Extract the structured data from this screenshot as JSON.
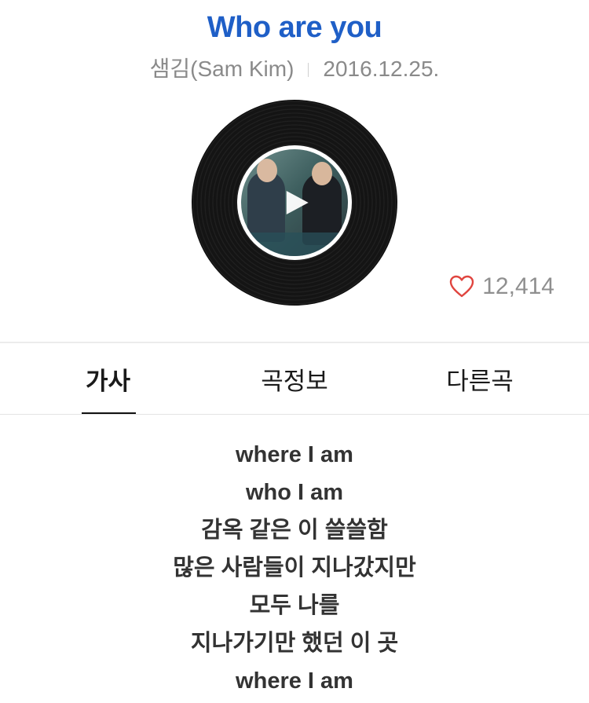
{
  "song": {
    "title": "Who are you",
    "artist": "샘김(Sam Kim)",
    "date": "2016.12.25."
  },
  "player": {
    "like_count": "12,414",
    "play_icon": "play-icon",
    "heart_icon": "heart-outline-icon"
  },
  "tabs": [
    {
      "label": "가사",
      "active": true
    },
    {
      "label": "곡정보",
      "active": false
    },
    {
      "label": "다른곡",
      "active": false
    }
  ],
  "lyrics": [
    "where I am",
    "who I am",
    "감옥 같은 이 쓸쓸함",
    "많은 사람들이 지나갔지만",
    "모두 나를",
    "지나가기만 했던 이 곳",
    "where I am"
  ],
  "colors": {
    "title": "#1f5fc7",
    "meta": "#8a8a8a",
    "heart": "#e0453f"
  }
}
